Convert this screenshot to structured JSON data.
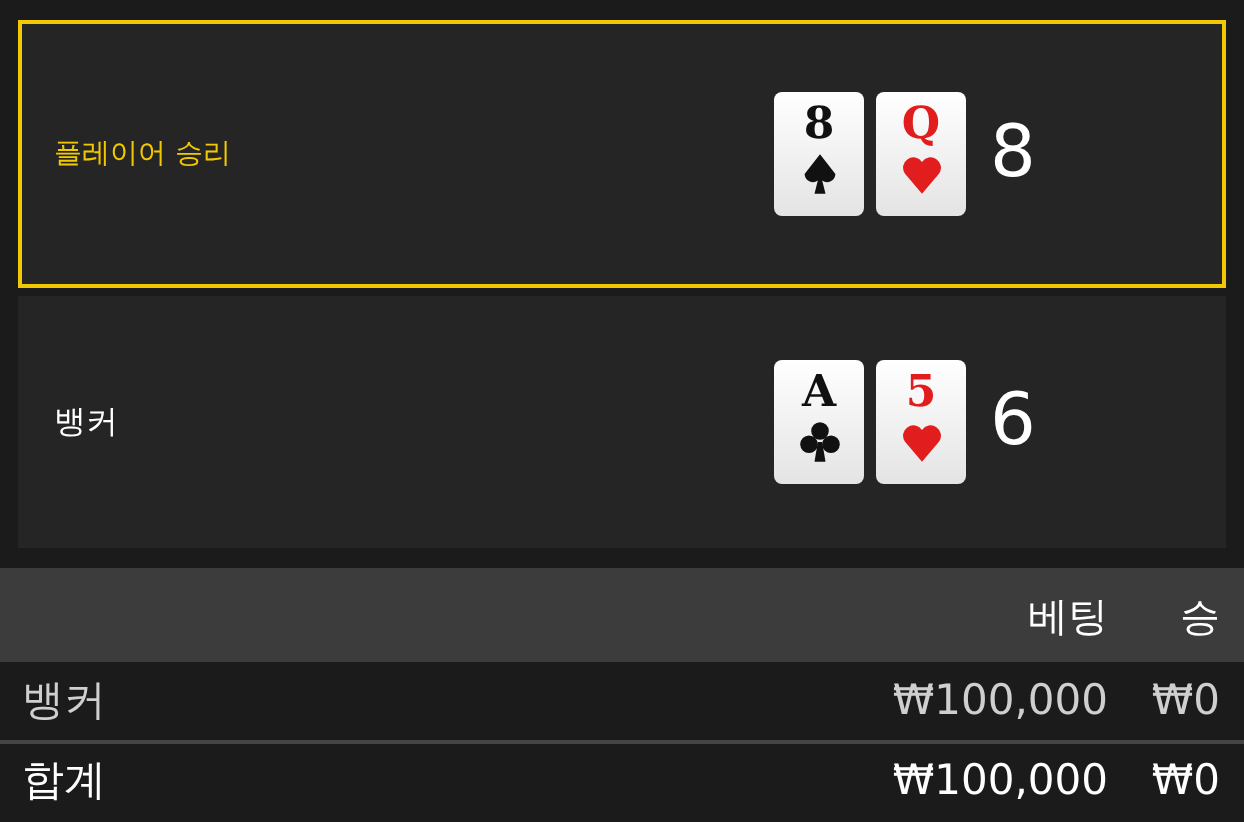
{
  "hands": [
    {
      "label": "플레이어 승리",
      "winner": true,
      "cards": [
        {
          "rank": "8",
          "kind": "spade"
        },
        {
          "rank": "Q",
          "kind": "heart"
        }
      ],
      "score": "8"
    },
    {
      "label": "뱅커",
      "winner": false,
      "cards": [
        {
          "rank": "A",
          "kind": "club"
        },
        {
          "rank": "5",
          "kind": "heart"
        }
      ],
      "score": "6"
    }
  ],
  "table": {
    "columns": [
      "베팅",
      "승"
    ],
    "rows": [
      {
        "kind": "bet",
        "label": "뱅커",
        "bet": "₩100,000",
        "win": "₩0"
      },
      {
        "kind": "total",
        "label": "합계",
        "bet": "₩100,000",
        "win": "₩0"
      }
    ]
  }
}
